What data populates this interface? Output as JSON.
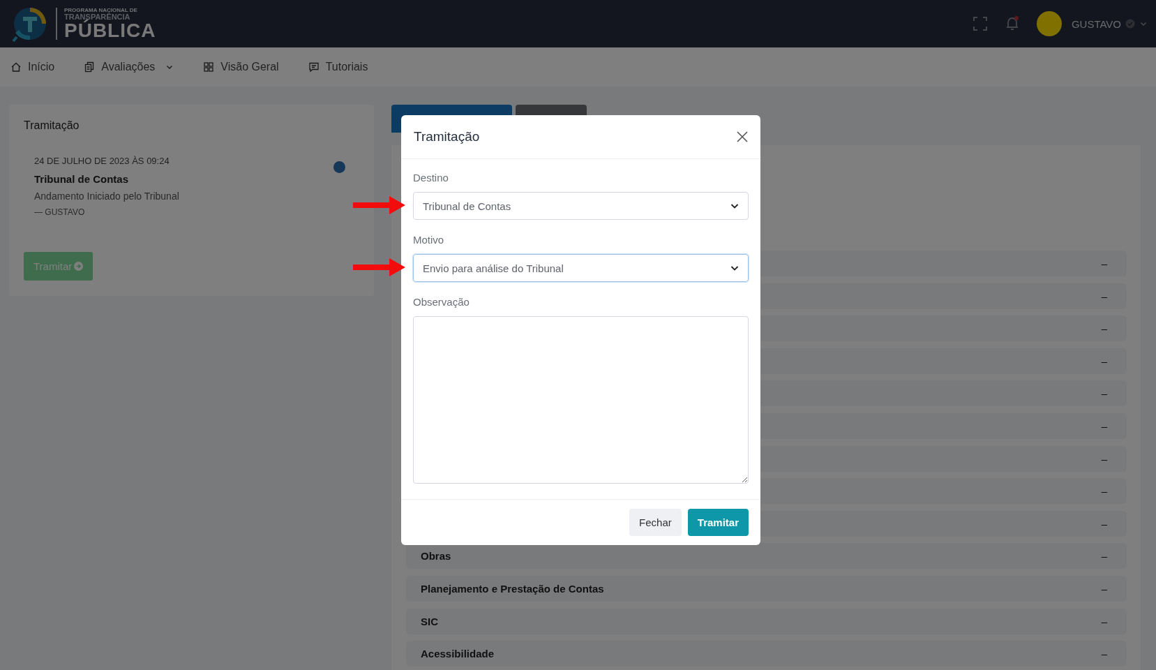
{
  "header": {
    "brand": {
      "top_line": "PROGRAMA NACIONAL DE",
      "middle_line": "TRANSPARÊNCIA",
      "main_line": "PÚBLICA"
    },
    "notifications": {
      "unread": true
    },
    "user": {
      "name": "GUSTAVO",
      "verified": true
    }
  },
  "nav": [
    {
      "label": "Início",
      "has_menu": false
    },
    {
      "label": "Avaliações",
      "has_menu": true
    },
    {
      "label": "Visão Geral",
      "has_menu": false
    },
    {
      "label": "Tutoriais",
      "has_menu": false
    }
  ],
  "sidebar_card": {
    "title": "Tramitação",
    "entries": [
      {
        "date": "24 DE JULHO DE 2023 ÀS 09:24",
        "destination": "Tribunal de Contas",
        "description": "Andamento Iniciado pelo Tribunal",
        "author": "— GUSTAVO"
      }
    ],
    "button": "Tramitar"
  },
  "panel": {
    "tabs": [
      {
        "selected": true
      },
      {
        "selected": false
      }
    ],
    "sections": [
      {
        "toggle": "–"
      },
      {
        "toggle": "–"
      },
      {
        "toggle": "–"
      },
      {
        "toggle": "–"
      },
      {
        "toggle": "–"
      },
      {
        "toggle": "–"
      },
      {
        "toggle": "–"
      },
      {
        "toggle": "–"
      },
      {
        "toggle": "–"
      },
      {
        "title": "Obras",
        "toggle": "–"
      },
      {
        "title": "Planejamento e Prestação de Contas",
        "toggle": "–"
      },
      {
        "title": "SIC",
        "toggle": "–"
      },
      {
        "title": "Acessibilidade",
        "toggle": "–"
      }
    ]
  },
  "modal": {
    "title": "Tramitação",
    "fields": [
      {
        "kind": "select",
        "label": "Destino",
        "value": "Tribunal de Contas",
        "focused": false,
        "marked": true
      },
      {
        "kind": "select",
        "label": "Motivo",
        "value": "Envio para análise do Tribunal",
        "focused": true,
        "marked": true
      },
      {
        "kind": "textarea",
        "label": "Observação",
        "marked": false
      }
    ],
    "buttons": [
      {
        "label": "Fechar",
        "kind": "secondary"
      },
      {
        "label": "Tramitar",
        "kind": "primary"
      }
    ]
  }
}
